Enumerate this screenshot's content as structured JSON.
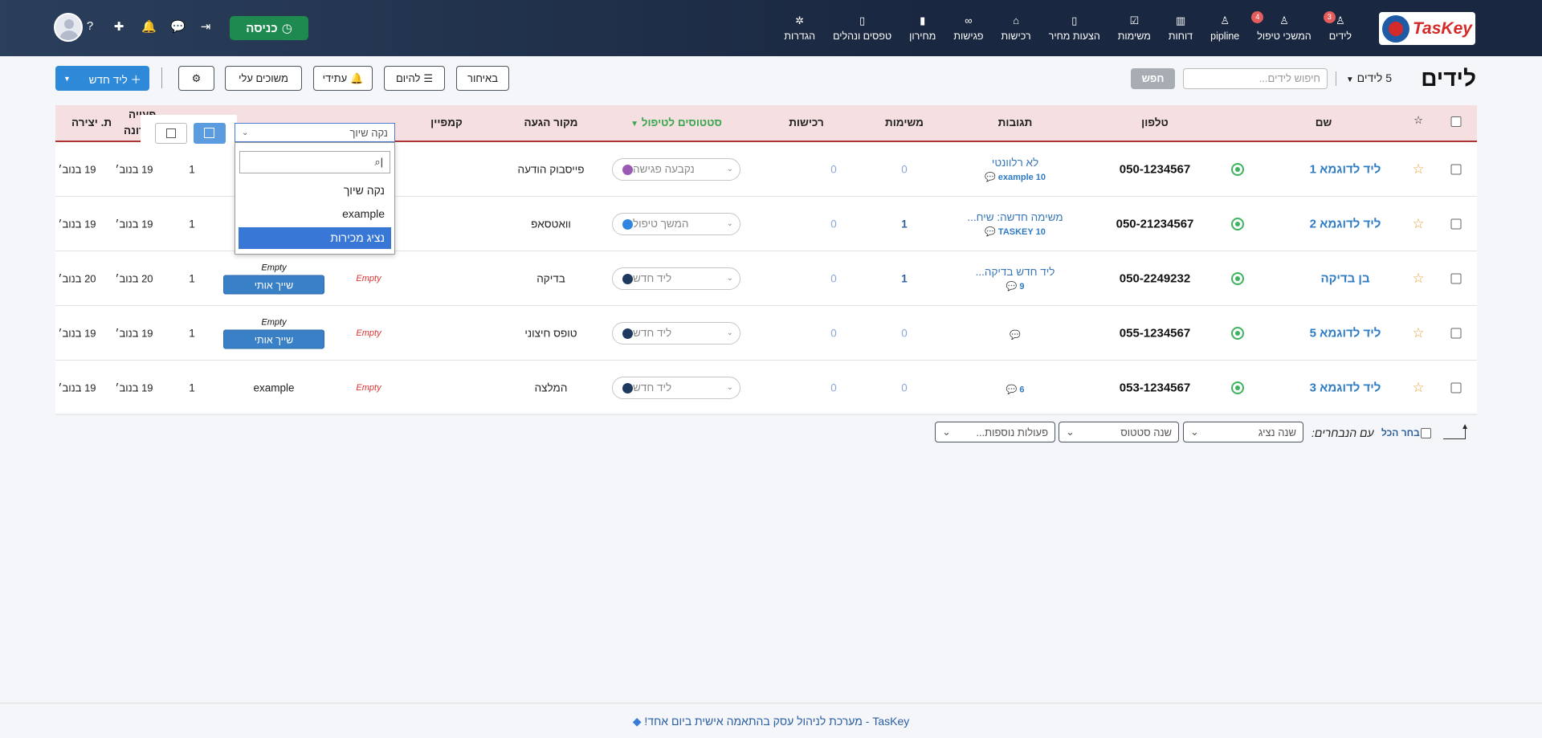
{
  "logo": {
    "text": "TasKey"
  },
  "nav": [
    {
      "label": "לידים",
      "icon": "user-icon",
      "badge": "3"
    },
    {
      "label": "המשכי טיפול",
      "icon": "user-icon",
      "badge": "4"
    },
    {
      "label": "pipline",
      "icon": "user-icon",
      "badge": ""
    },
    {
      "label": "דוחות",
      "icon": "chart-icon",
      "badge": ""
    },
    {
      "label": "משימות",
      "icon": "checkbox-icon",
      "badge": ""
    },
    {
      "label": "הצעות מחיר",
      "icon": "document-icon",
      "badge": ""
    },
    {
      "label": "רכישות",
      "icon": "bag-icon",
      "badge": ""
    },
    {
      "label": "פגישות",
      "icon": "handshake-icon",
      "badge": ""
    },
    {
      "label": "מחירון",
      "icon": "barcode-icon",
      "badge": ""
    },
    {
      "label": "טפסים ונהלים",
      "icon": "book-icon",
      "badge": ""
    },
    {
      "label": "הגדרות",
      "icon": "gear-icon",
      "badge": ""
    }
  ],
  "top": {
    "enter_label": "כניסה"
  },
  "page": {
    "title": "לידים",
    "count_label": "5 לידים"
  },
  "search": {
    "placeholder": "חיפוש לידים...",
    "button": "חפש"
  },
  "toolbar": {
    "late": "באיחור",
    "today": "להיום",
    "future": "עתידי",
    "mine": "משוכים עלי",
    "new_lead": "ליד חדש"
  },
  "columns": {
    "name": "שם",
    "phone": "טלפון",
    "responses": "תגובות",
    "tasks": "משימות",
    "purchases": "רכישות",
    "statuses": "סטטוסים לטיפול",
    "source": "מקור הגעה",
    "campaign": "קמפיין",
    "last_action_1": "פעייה",
    "last_action_2": "רונה",
    "created": "ת. יצירה"
  },
  "dropdown": {
    "selected": "נקה שיוך",
    "search_value": "",
    "options": [
      "נקה שיוך",
      "example",
      "נציג מכירות"
    ]
  },
  "rows": [
    {
      "name": "ליד לדוגמא 1",
      "phone": "050-1234567",
      "resp_text": "לא רלוונטי",
      "resp_meta": "example 10",
      "tasks": "0",
      "purchases": "0",
      "status": "נקבעה פגישה",
      "status_color": "#9b59b6",
      "source": "פייסבוק הודעה",
      "campaign": "",
      "assign_top": "",
      "assign": "",
      "count": "1",
      "last": "19 בנוב׳",
      "created": "19 בנוב׳"
    },
    {
      "name": "ליד לדוגמא 2",
      "phone": "050-21234567",
      "resp_text": "משימה חדשה: שיח...",
      "resp_meta": "TASKEY 10",
      "tasks": "1",
      "purchases": "0",
      "status": "המשך טיפול",
      "status_color": "#2e86de",
      "source": "וואטסאפ",
      "campaign": "",
      "assign_top": "",
      "assign": "",
      "count": "1",
      "last": "19 בנוב׳",
      "created": "19 בנוב׳"
    },
    {
      "name": "בן בדיקה",
      "phone": "050-2249232",
      "resp_text": "ליד חדש בדיקה...",
      "resp_meta": "9",
      "tasks": "1",
      "purchases": "0",
      "status": "ליד חדש",
      "status_color": "#1e3a5f",
      "source": "בדיקה",
      "campaign": "Empty",
      "assign_top": "Empty",
      "assign": "שייך אותי",
      "count": "1",
      "last": "20 בנוב׳",
      "created": "20 בנוב׳"
    },
    {
      "name": "ליד לדוגמא 5",
      "phone": "055-1234567",
      "resp_text": "",
      "resp_meta": "",
      "tasks": "0",
      "purchases": "0",
      "status": "ליד חדש",
      "status_color": "#1e3a5f",
      "source": "טופס חיצוני",
      "campaign": "Empty",
      "assign_top": "Empty",
      "assign": "שייך אותי",
      "count": "1",
      "last": "19 בנוב׳",
      "created": "19 בנוב׳"
    },
    {
      "name": "ליד לדוגמא 3",
      "phone": "053-1234567",
      "resp_text": "",
      "resp_meta": "6",
      "tasks": "0",
      "purchases": "0",
      "status": "ליד חדש",
      "status_color": "#1e3a5f",
      "source": "המלצה",
      "campaign": "Empty",
      "assign_top": "",
      "assign_text": "example",
      "count": "1",
      "last": "19 בנוב׳",
      "created": "19 בנוב׳"
    }
  ],
  "bulk": {
    "select_all": "בחר הכל",
    "with_selected": "עם הנבחרים:",
    "change_rep": "שנה נציג",
    "change_status": "שנה סטטוס",
    "more_actions": "פעולות נוספות..."
  },
  "footer": {
    "text": "TasKey - מערכת לניהול עסק בהתאמה אישית ביום אחד!"
  }
}
